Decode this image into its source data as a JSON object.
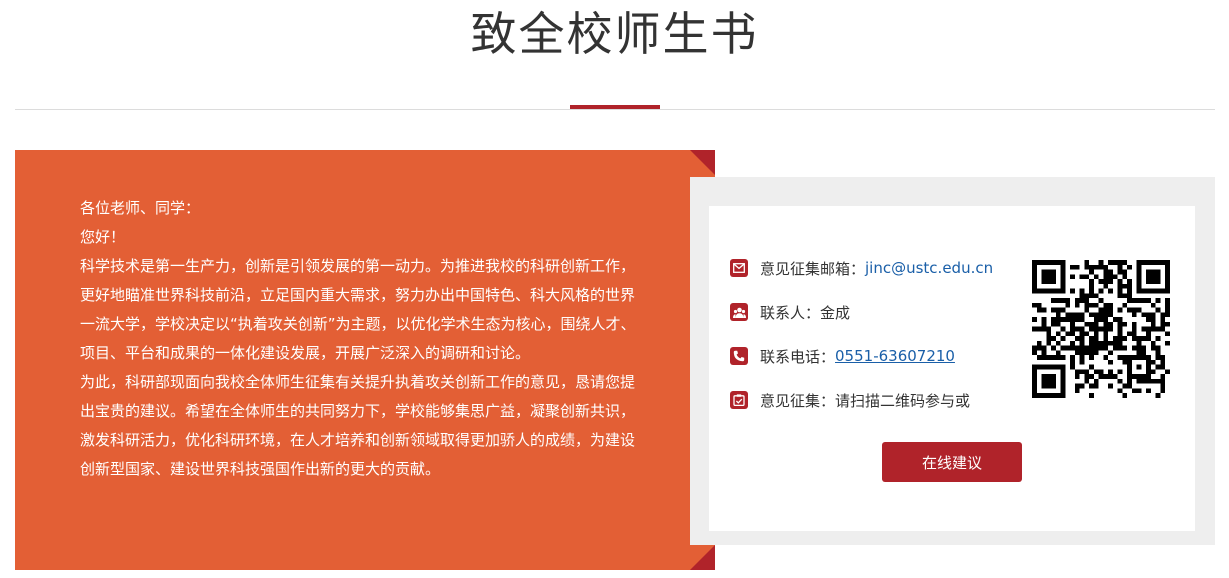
{
  "header": {
    "title": "致全校师生书"
  },
  "letter": {
    "greeting": "各位老师、同学：",
    "hello": "您好！",
    "paragraph1": "科学技术是第一生产力，创新是引领发展的第一动力。为推进我校的科研创新工作，更好地瞄准世界科技前沿，立足国内重大需求，努力办出中国特色、科大风格的世界一流大学，学校决定以“执着攻关创新”为主题，以优化学术生态为核心，围绕人才、项目、平台和成果的一体化建设发展，开展广泛深入的调研和讨论。",
    "paragraph2": "为此，科研部现面向我校全体师生征集有关提升执着攻关创新工作的意见，恳请您提出宝贵的建议。希望在全体师生的共同努力下，学校能够集思广益，凝聚创新共识，激发科研活力，优化科研环境，在人才培养和创新领域取得更加骄人的成绩，为建设创新型国家、建设世界科技强国作出新的更大的贡献。"
  },
  "contact": {
    "email_label": "意见征集邮箱：",
    "email_value": "jinc@ustc.edu.cn",
    "person_label": "联系人：",
    "person_value": "金成",
    "phone_label": "联系电话：",
    "phone_value": "0551-63607210",
    "collect_label": "意见征集：",
    "collect_value": "请扫描二维码参与或",
    "button_label": "在线建议"
  },
  "icons": {
    "email": "mail-icon",
    "person": "people-icon",
    "phone": "phone-icon",
    "collect": "clipboard-icon",
    "qr": "qr-code"
  },
  "colors": {
    "accent_red": "#b0232a",
    "letter_orange": "#e35f35",
    "link_blue": "#1a5fa8"
  }
}
